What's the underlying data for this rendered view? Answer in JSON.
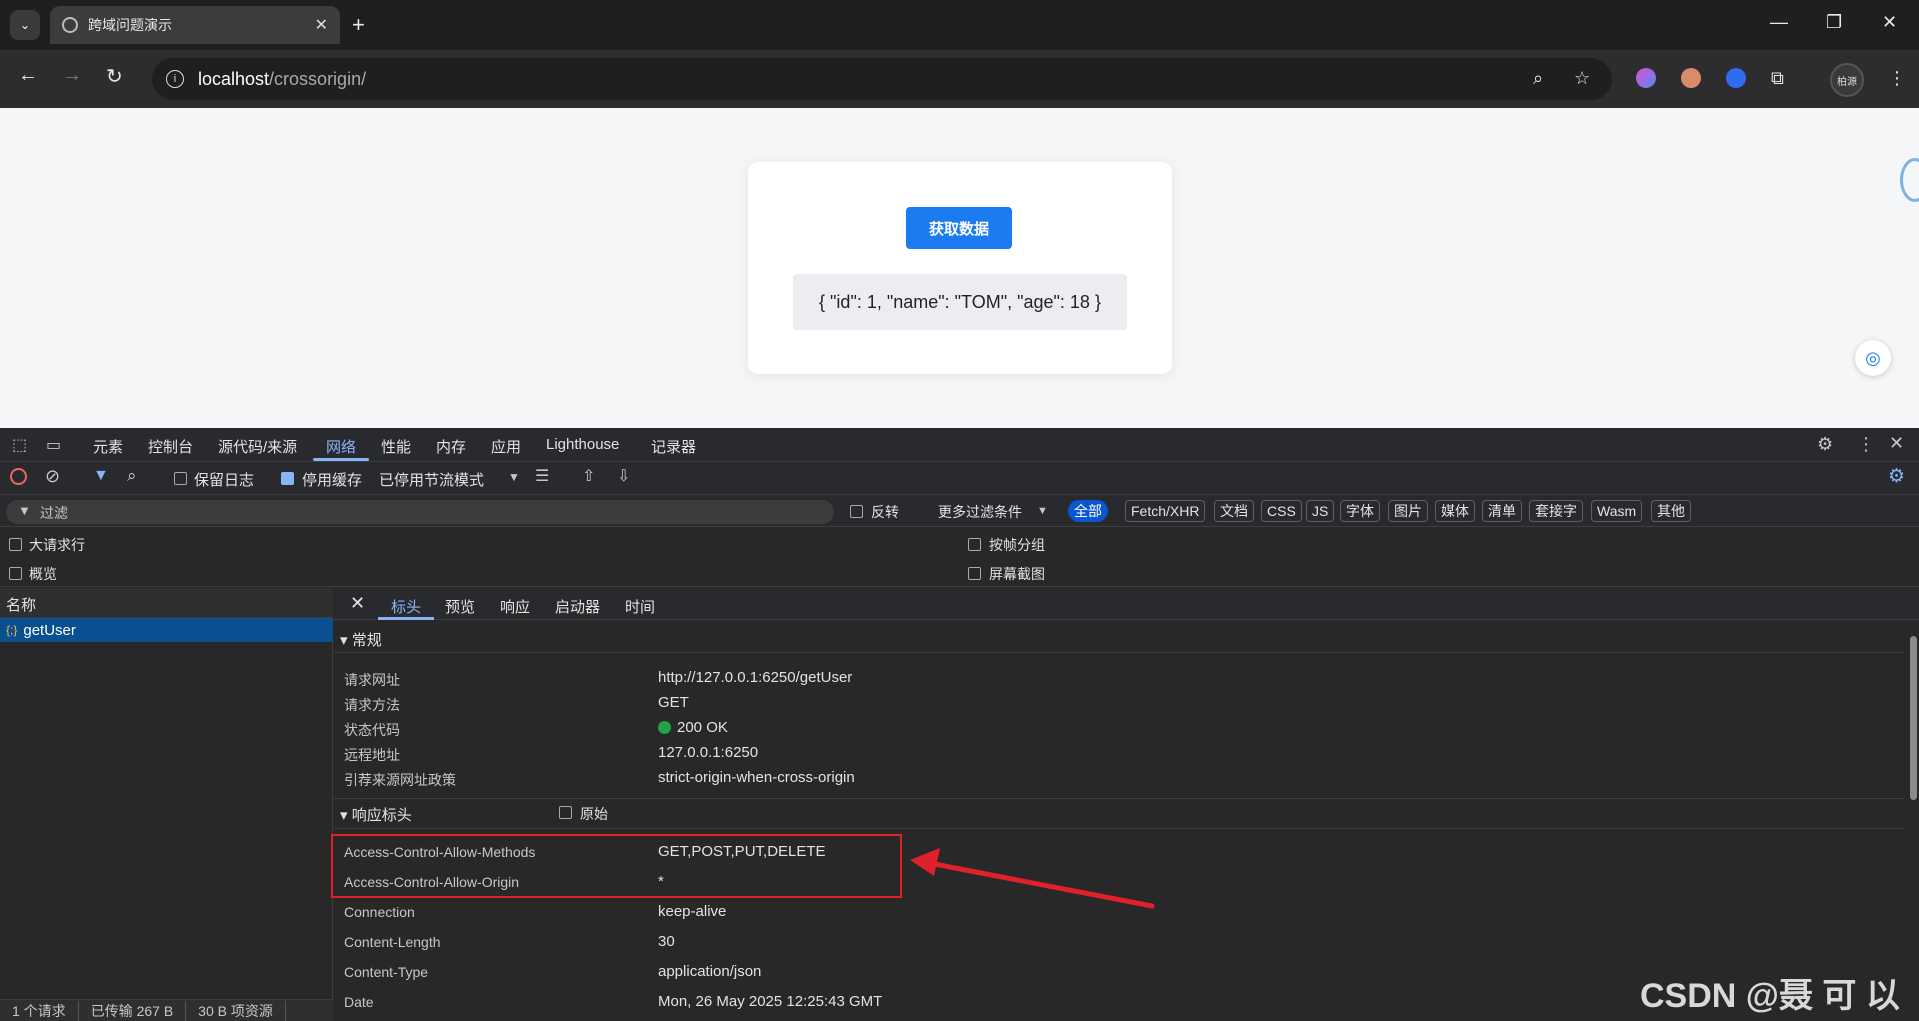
{
  "browser": {
    "tab_title": "跨域问题演示",
    "url_host": "localhost",
    "url_path": "/crossorigin/",
    "profile_label": "柏源"
  },
  "page": {
    "button_label": "获取数据",
    "result_text": "{ \"id\": 1, \"name\": \"TOM\", \"age\": 18 }"
  },
  "devtools": {
    "tabs": [
      "元素",
      "控制台",
      "源代码/来源",
      "网络",
      "性能",
      "内存",
      "应用",
      "Lighthouse",
      "记录器"
    ],
    "active_tab": "网络",
    "controls": {
      "preserve_log": "保留日志",
      "disable_cache": "停用缓存",
      "throttling": "已停用节流模式"
    },
    "filter": {
      "placeholder": "过滤",
      "invert": "反转",
      "more_filters": "更多过滤条件",
      "types": [
        "全部",
        "Fetch/XHR",
        "文档",
        "CSS",
        "JS",
        "字体",
        "图片",
        "媒体",
        "清单",
        "套接字",
        "Wasm",
        "其他"
      ]
    },
    "options": {
      "large_rows": "大请求行",
      "overview": "概览",
      "group_by_frame": "按帧分组",
      "screenshots": "屏幕截图"
    },
    "name_header": "名称",
    "request": {
      "name": "getUser",
      "type_icon": "{;}"
    },
    "status_bar": [
      "1 个请求",
      "已传输 267 B",
      "30 B 项资源"
    ],
    "detail_tabs": [
      "标头",
      "预览",
      "响应",
      "启动器",
      "时间"
    ],
    "general": {
      "title": "常规",
      "rows": [
        {
          "k": "请求网址",
          "v": "http://127.0.0.1:6250/getUser"
        },
        {
          "k": "请求方法",
          "v": "GET"
        },
        {
          "k": "状态代码",
          "v": "200 OK"
        },
        {
          "k": "远程地址",
          "v": "127.0.0.1:6250"
        },
        {
          "k": "引荐来源网址政策",
          "v": "strict-origin-when-cross-origin"
        }
      ]
    },
    "response_headers": {
      "title": "响应标头",
      "raw": "原始",
      "rows": [
        {
          "k": "Access-Control-Allow-Methods",
          "v": "GET,POST,PUT,DELETE"
        },
        {
          "k": "Access-Control-Allow-Origin",
          "v": "*"
        },
        {
          "k": "Connection",
          "v": "keep-alive"
        },
        {
          "k": "Content-Length",
          "v": "30"
        },
        {
          "k": "Content-Type",
          "v": "application/json"
        },
        {
          "k": "Date",
          "v": "Mon, 26 May 2025 12:25:43 GMT"
        }
      ]
    }
  },
  "watermark": "CSDN @聂 可 以"
}
